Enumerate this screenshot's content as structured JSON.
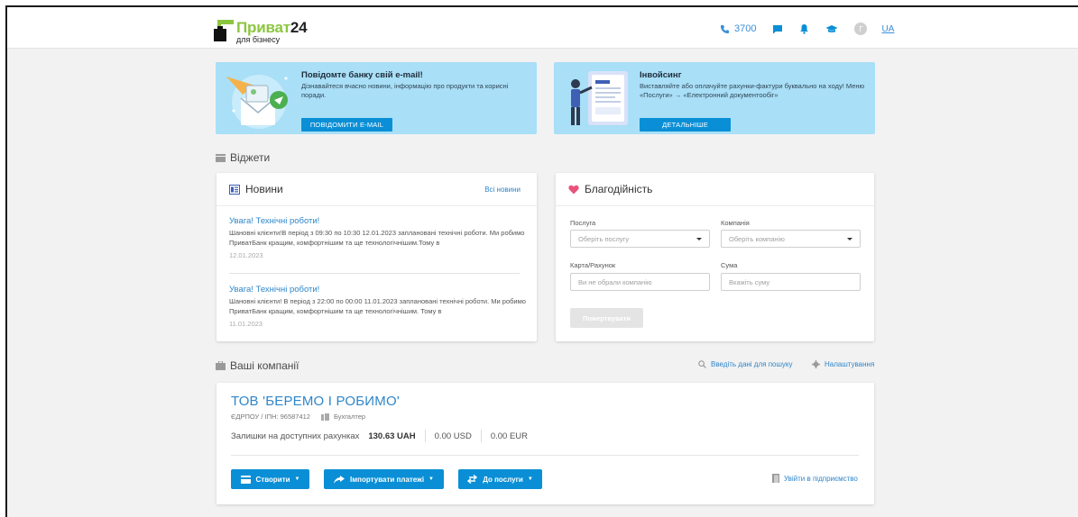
{
  "header": {
    "logo_title": "Приват",
    "logo_number": "24",
    "logo_subtitle": "для бізнесу",
    "phone": "3700",
    "avatar_letter": "Г",
    "language": "UA"
  },
  "banners": {
    "email": {
      "title": "Повідомте банку свій e-mail!",
      "text": "Дізнавайтеся вчасно новини, інформацію про продукти та корисні поради.",
      "button": "ПОВІДОМИТИ E-MAIL"
    },
    "invoicing": {
      "title": "Інвойсинг",
      "text": "Виставляйте або оплачуйте рахунки-фактури буквально на ходу! Меню «Послуги» → «Електронний документообіг»",
      "button": "ДЕТАЛЬНІШЕ"
    }
  },
  "widgets": {
    "section_title": "Віджети",
    "news": {
      "title": "Новини",
      "all_link": "Всі новини",
      "items": [
        {
          "title": "Увага! Технічні роботи!",
          "body": "Шановні клієнти!В період з 09:30 по 10:30 12.01.2023 заплановані технічні роботи. Ми робимо ПриватБанк кращим, комфортнішим та ще технологічнішим.Тому в",
          "date": "12.01.2023"
        },
        {
          "title": "Увага! Технічні роботи!",
          "body": "Шановні клієнти! В період з 22:00 по 00:00 11.01.2023 заплановані технічні роботи. Ми робимо ПриватБанк кращим, комфортнішим та ще технологічнішим. Тому в",
          "date": "11.01.2023"
        }
      ]
    },
    "charity": {
      "title": "Благодійність",
      "service_label": "Послуга",
      "service_placeholder": "Оберіть послугу",
      "company_label": "Компанія",
      "company_placeholder": "Оберіть компанію",
      "card_label": "Карта/Рахунок",
      "card_placeholder": "Ви не обрали компанію",
      "sum_label": "Сума",
      "sum_placeholder": "Вкажіть суму",
      "donate_button": "Пожертвувати"
    }
  },
  "companies": {
    "section_title": "Ваші компанії",
    "search_link": "Введіть дані для пошуку",
    "settings_link": "Налаштування",
    "company": {
      "name": "ТОВ 'БЕРЕМО І РОБИМО'",
      "edrpou": "ЄДРПОУ / ІПН: 96587412",
      "role": "Бухгалтер",
      "balance_label": "Залишки на доступних рахунках",
      "balance_uah": "130.63 UAH",
      "balance_usd": "0.00 USD",
      "balance_eur": "0.00 EUR",
      "btn_create": "Створити",
      "btn_import": "Імпортувати платежі",
      "btn_service": "До послуги",
      "enter_link": "Увійти в підприємство"
    }
  },
  "colors": {
    "accent": "#0a8fd6",
    "link": "#2f86c9",
    "logo_green": "#8cc63f",
    "banner_bg": "#a9dff7",
    "heart": "#e8537a"
  }
}
